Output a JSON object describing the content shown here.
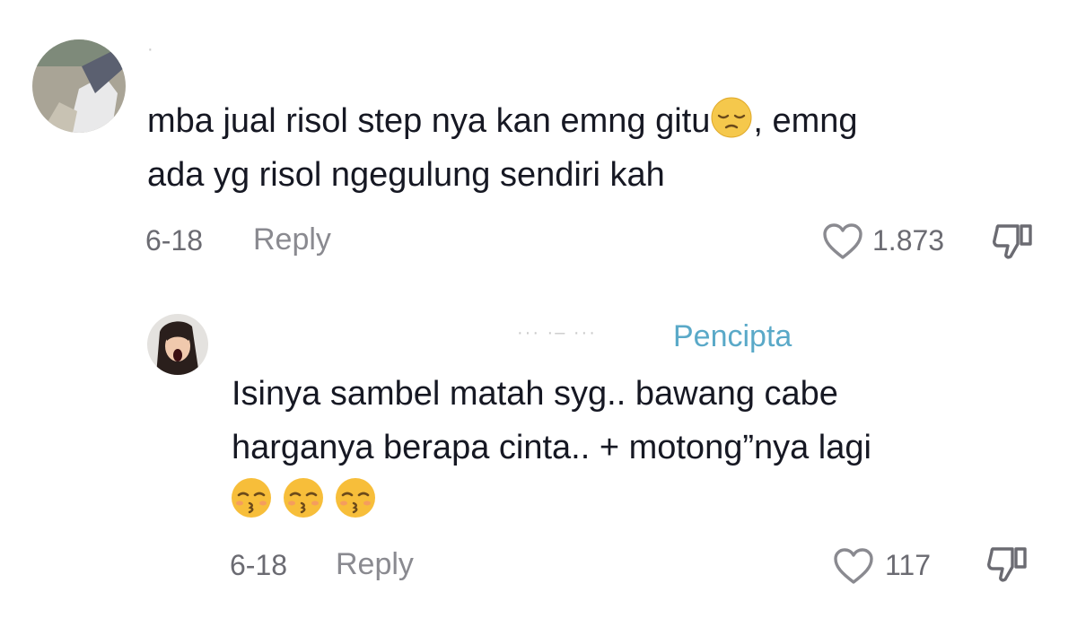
{
  "comment1": {
    "username": "·",
    "text_line1": "mba jual risol step nya kan emng gitu",
    "text_line1_after": ", emng",
    "text_line2": "ada yg risol ngegulung sendiri kah",
    "emoji": "pensive-face",
    "date": "6-18",
    "reply_label": "Reply",
    "likes": "1.873"
  },
  "comment2": {
    "username": "··· ·– ···",
    "badge": "Pencipta",
    "text_line1": "Isinya sambel matah syg.. bawang cabe",
    "text_line2": "harganya berapa cinta.. + motong”nya lagi",
    "emojis": [
      "kissing-face-closed-eyes",
      "kissing-face-closed-eyes",
      "kissing-face-closed-eyes"
    ],
    "date": "6-18",
    "reply_label": "Reply",
    "likes": "117"
  },
  "colors": {
    "text": "#161823",
    "meta": "#6b6b72",
    "reply": "#8a8a90",
    "creator_badge": "#5aa9c8"
  }
}
